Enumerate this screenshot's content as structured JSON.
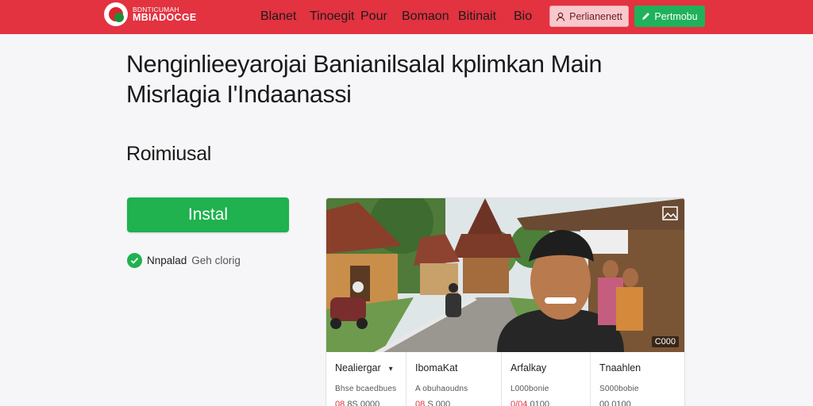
{
  "header": {
    "logo_small": "BDNTICUMAH",
    "logo_big": "MBIADOCGE",
    "nav": [
      "Blanet",
      "Tinoegit",
      "Pour",
      "Bomaon",
      "Bitinait",
      "Bio"
    ],
    "login_label": "Perlianenett",
    "register_label": "Pertmobu",
    "colors": {
      "bar": "#e33240",
      "login_bg": "#f7c9cd",
      "register_bg": "#1fb25b"
    }
  },
  "main": {
    "title_line1": "Nenginlieeyarojai Banianilsalal kplimkan Main",
    "title_line2": "Misrlagia I'Indaanassi",
    "section_title": "Roimiusal",
    "install_label": "Instal",
    "verified_label": "Nnpalad",
    "verified_sub": "Geh clorig",
    "accent": "#1fb24f"
  },
  "card": {
    "image_badge": "C000",
    "image_description_icon": "image-icon",
    "columns": [
      {
        "label": "Nealiergar",
        "has_dropdown": true,
        "sub": "Bhse bcaedbues",
        "value_red": "08",
        "value": "8S 0000"
      },
      {
        "label": "IbomaKat",
        "has_dropdown": false,
        "sub": "A obuhaoudns",
        "value_red": "08",
        "value": "S 000"
      },
      {
        "label": "Arfalkay",
        "has_dropdown": false,
        "sub": "L000bonie",
        "value_red": "0/04",
        "value": "0100"
      },
      {
        "label": "Tnaahlen",
        "has_dropdown": false,
        "sub": "S000bobie",
        "value_red": "",
        "value": "00 0100"
      }
    ]
  }
}
